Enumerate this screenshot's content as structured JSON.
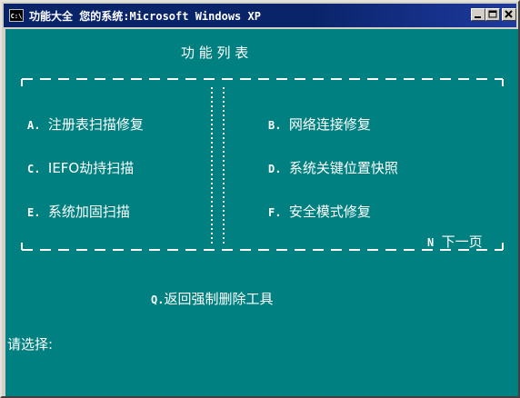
{
  "window": {
    "icon_text": "C:\\",
    "title": "功能大全 您的系统:Microsoft Windows XP",
    "controls": {
      "minimize": "minimize-icon",
      "maximize": "maximize-icon",
      "close": "close-icon"
    }
  },
  "console": {
    "bg_color": "#008080",
    "fg_color": "#ffffff",
    "heading": "功 能 列 表",
    "items": [
      {
        "key": "A.",
        "label": "注册表扫描修复"
      },
      {
        "key": "B.",
        "label": "网络连接修复"
      },
      {
        "key": "C.",
        "label": "IEFO劫持扫描"
      },
      {
        "key": "D.",
        "label": "系统关键位置快照"
      },
      {
        "key": "E.",
        "label": "系统加固扫描"
      },
      {
        "key": "F.",
        "label": "安全模式修复"
      }
    ],
    "next_page": {
      "key": "N",
      "label": "下一页"
    },
    "back_option": {
      "key": "Q.",
      "label": "返回强制删除工具"
    },
    "prompt": "请选择:"
  }
}
